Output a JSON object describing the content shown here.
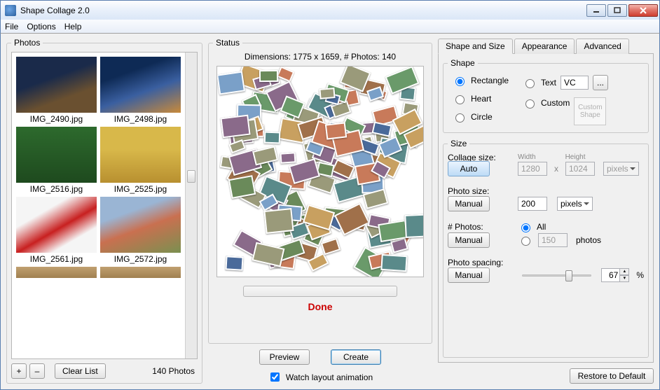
{
  "window": {
    "title": "Shape Collage 2.0"
  },
  "menu": {
    "file": "File",
    "options": "Options",
    "help": "Help"
  },
  "photos": {
    "legend": "Photos",
    "items": [
      {
        "cap": "IMG_2490.jpg"
      },
      {
        "cap": "IMG_2498.jpg"
      },
      {
        "cap": "IMG_2516.jpg"
      },
      {
        "cap": "IMG_2525.jpg"
      },
      {
        "cap": "IMG_2561.jpg"
      },
      {
        "cap": "IMG_2572.jpg"
      }
    ],
    "add": "+",
    "remove": "–",
    "clear": "Clear List",
    "count": "140 Photos"
  },
  "status": {
    "legend": "Status",
    "dims": "Dimensions: 1775 x 1659, # Photos: 140",
    "done": "Done",
    "preview": "Preview",
    "create": "Create",
    "watch": "Watch layout animation",
    "watch_checked": true
  },
  "tabs": {
    "shape": "Shape and Size",
    "appearance": "Appearance",
    "advanced": "Advanced"
  },
  "shape": {
    "legend": "Shape",
    "rectangle": "Rectangle",
    "heart": "Heart",
    "circle": "Circle",
    "text": "Text",
    "text_value": "VC",
    "browse": "...",
    "custom": "Custom",
    "custom_shape_placeholder": "Custom\nShape",
    "selected": "rectangle"
  },
  "size": {
    "legend": "Size",
    "collage_label": "Collage size:",
    "auto": "Auto",
    "width_label": "Width",
    "width_value": "1280",
    "height_label": "Height",
    "height_value": "1024",
    "unit_pixels": "pixels",
    "photo_label": "Photo size:",
    "manual": "Manual",
    "photo_value": "200",
    "nphotos_label": "# Photos:",
    "all": "All",
    "nphotos_value": "150",
    "photos_word": "photos",
    "spacing_label": "Photo spacing:",
    "spacing_value": "67",
    "percent": "%"
  },
  "restore": "Restore to Default"
}
